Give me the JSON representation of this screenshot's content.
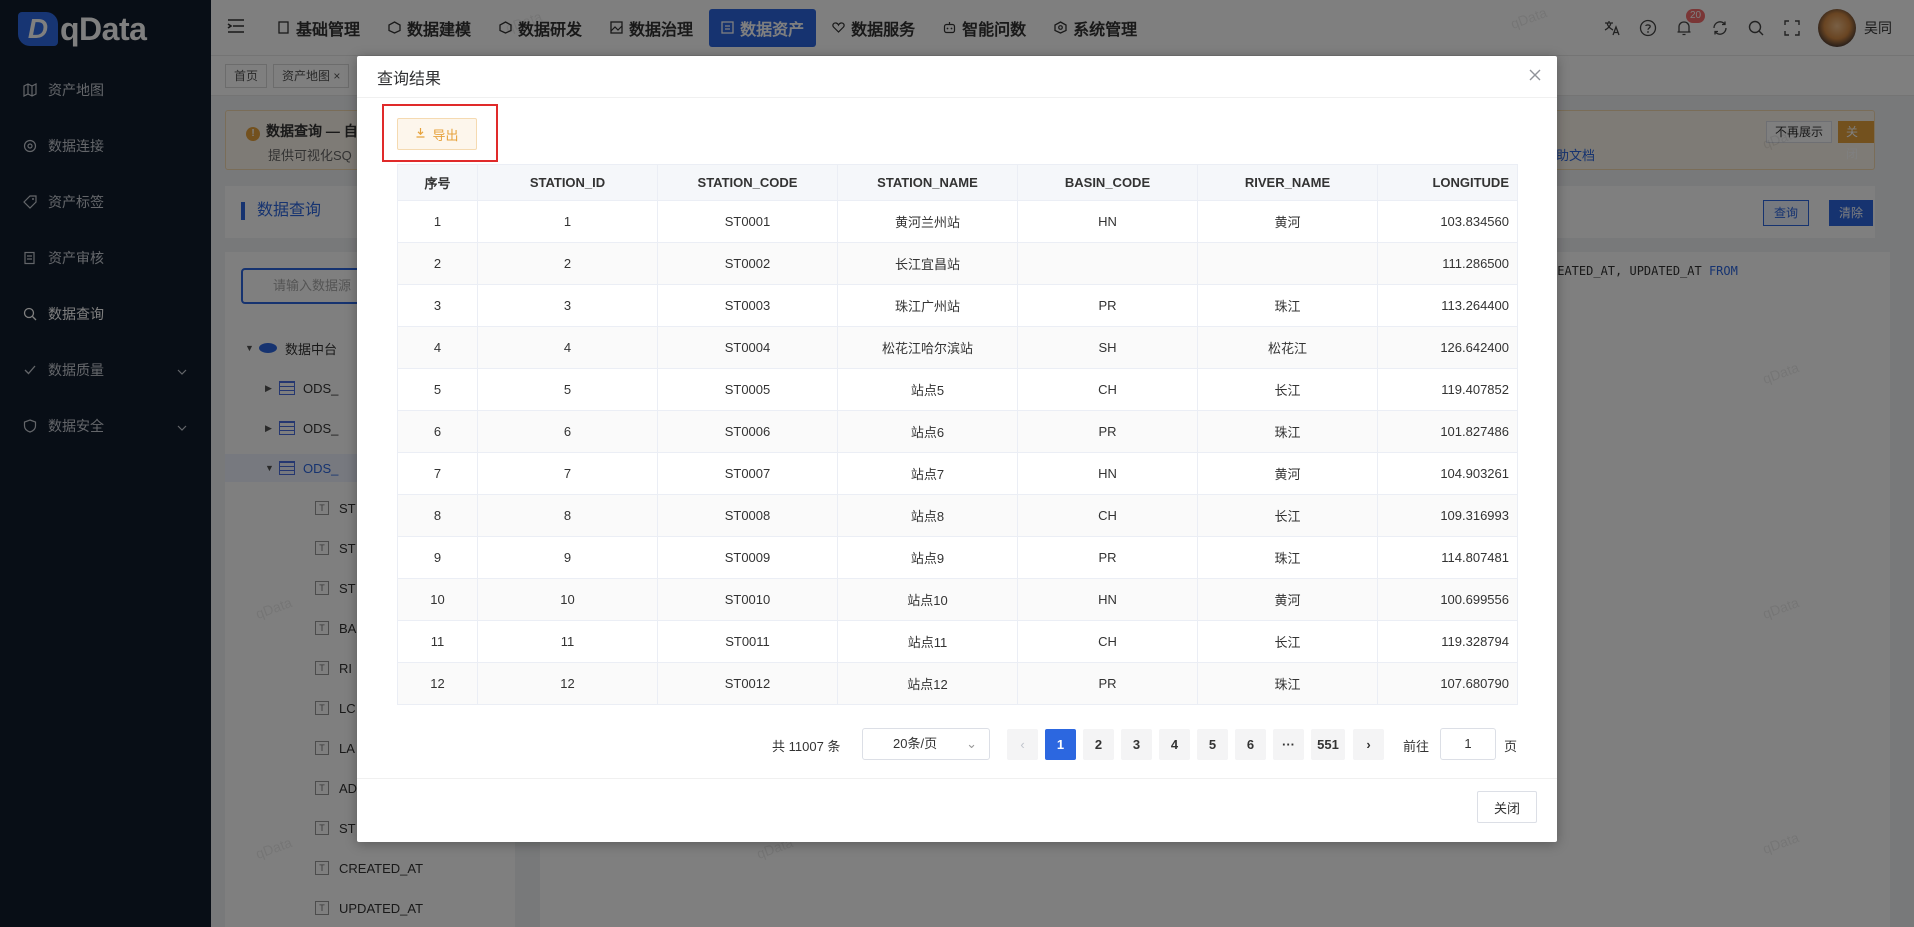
{
  "app": {
    "logo_text": "qData",
    "logo_mark": "D"
  },
  "sidebar": {
    "items": [
      {
        "label": "资产地图",
        "icon": "map-icon"
      },
      {
        "label": "数据连接",
        "icon": "link-icon"
      },
      {
        "label": "资产标签",
        "icon": "tag-icon"
      },
      {
        "label": "资产审核",
        "icon": "audit-icon"
      },
      {
        "label": "数据查询",
        "icon": "query-icon"
      },
      {
        "label": "数据质量",
        "icon": "quality-icon"
      },
      {
        "label": "数据安全",
        "icon": "security-icon"
      }
    ]
  },
  "header": {
    "nav": [
      {
        "label": "基础管理"
      },
      {
        "label": "数据建模"
      },
      {
        "label": "数据研发"
      },
      {
        "label": "数据治理"
      },
      {
        "label": "数据资产"
      },
      {
        "label": "数据服务"
      },
      {
        "label": "智能问数"
      },
      {
        "label": "系统管理"
      }
    ],
    "bell_badge": "20",
    "username": "吴同"
  },
  "tags": {
    "home": "首页",
    "asset_map": "资产地图",
    "close": "×"
  },
  "notice": {
    "title": "数据查询 — 自",
    "desc": "提供可视化SQ",
    "link": "助文档",
    "no_show": "不再展示",
    "close": "关闭"
  },
  "panel": {
    "title": "数据查询",
    "search_placeholder": "请输入数据源",
    "query_btn": "查询",
    "clear_btn": "清除",
    "sql_text": "REATED_AT, UPDATED_AT ",
    "sql_kw": "FROM",
    "tree_root": "数据中台",
    "tree_tables": [
      "ODS_",
      "ODS_",
      "ODS_"
    ],
    "tree_fields": [
      "ST",
      "ST",
      "ST",
      "BA",
      "RI",
      "LC",
      "LA",
      "AD",
      "ST",
      "CREATED_AT",
      "UPDATED_AT"
    ]
  },
  "watermark": "qData",
  "dialog": {
    "title": "查询结果",
    "export_label": "导出",
    "columns": [
      "序号",
      "STATION_ID",
      "STATION_CODE",
      "STATION_NAME",
      "BASIN_CODE",
      "RIVER_NAME",
      "LONGITUDE"
    ],
    "rows": [
      [
        "1",
        "1",
        "ST0001",
        "黄河兰州站",
        "HN",
        "黄河",
        "103.834560"
      ],
      [
        "2",
        "2",
        "ST0002",
        "长江宜昌站",
        "",
        "",
        "111.286500"
      ],
      [
        "3",
        "3",
        "ST0003",
        "珠江广州站",
        "PR",
        "珠江",
        "113.264400"
      ],
      [
        "4",
        "4",
        "ST0004",
        "松花江哈尔滨站",
        "SH",
        "松花江",
        "126.642400"
      ],
      [
        "5",
        "5",
        "ST0005",
        "站点5",
        "CH",
        "长江",
        "119.407852"
      ],
      [
        "6",
        "6",
        "ST0006",
        "站点6",
        "PR",
        "珠江",
        "101.827486"
      ],
      [
        "7",
        "7",
        "ST0007",
        "站点7",
        "HN",
        "黄河",
        "104.903261"
      ],
      [
        "8",
        "8",
        "ST0008",
        "站点8",
        "CH",
        "长江",
        "109.316993"
      ],
      [
        "9",
        "9",
        "ST0009",
        "站点9",
        "PR",
        "珠江",
        "114.807481"
      ],
      [
        "10",
        "10",
        "ST0010",
        "站点10",
        "HN",
        "黄河",
        "100.699556"
      ],
      [
        "11",
        "11",
        "ST0011",
        "站点11",
        "CH",
        "长江",
        "119.328794"
      ],
      [
        "12",
        "12",
        "ST0012",
        "站点12",
        "PR",
        "珠江",
        "107.680790"
      ]
    ],
    "pagination": {
      "total": "共 11007 条",
      "page_size": "20条/页",
      "pages": [
        "1",
        "2",
        "3",
        "4",
        "5",
        "6",
        "···",
        "551"
      ],
      "current": "1",
      "prev": "‹",
      "next": "›",
      "goto_label": "前往",
      "goto_value": "1",
      "goto_unit": "页"
    },
    "close_label": "关闭"
  }
}
